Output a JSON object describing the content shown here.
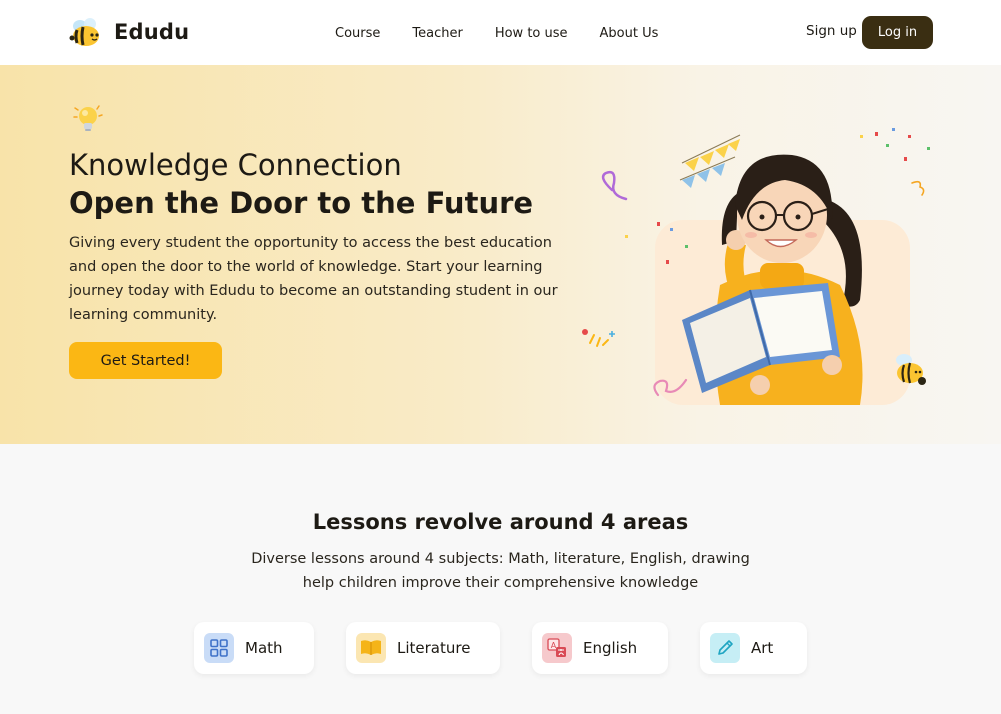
{
  "brand": {
    "name": "Edudu"
  },
  "nav": {
    "links": [
      "Course",
      "Teacher",
      "How to use",
      "About Us"
    ],
    "signup": "Sign up",
    "login": "Log in"
  },
  "hero": {
    "title_line1": "Knowledge Connection",
    "title_line2": "Open the Door to the Future",
    "description": "Giving every student the opportunity to access the best education and open the door to the world of knowledge. Start your learning journey today with Edudu to become an outstanding student in our learning community.",
    "cta": "Get Started!"
  },
  "lessons": {
    "title": "Lessons revolve around 4 areas",
    "description_line1": "Diverse lessons around 4 subjects: Math, literature, English, drawing",
    "description_line2": "help children improve their comprehensive knowledge",
    "subjects": [
      {
        "label": "Math",
        "icon": "grid-icon",
        "color": "#c9dcf7"
      },
      {
        "label": "Literature",
        "icon": "book-icon",
        "color": "#fbe6b2"
      },
      {
        "label": "English",
        "icon": "translate-icon",
        "color": "#f6c9cc"
      },
      {
        "label": "Art",
        "icon": "pencil-icon",
        "color": "#c6eef5"
      }
    ]
  },
  "colors": {
    "accent": "#fbb714",
    "dark": "#3a2e12",
    "hero_bg": "#f8e3a9"
  }
}
